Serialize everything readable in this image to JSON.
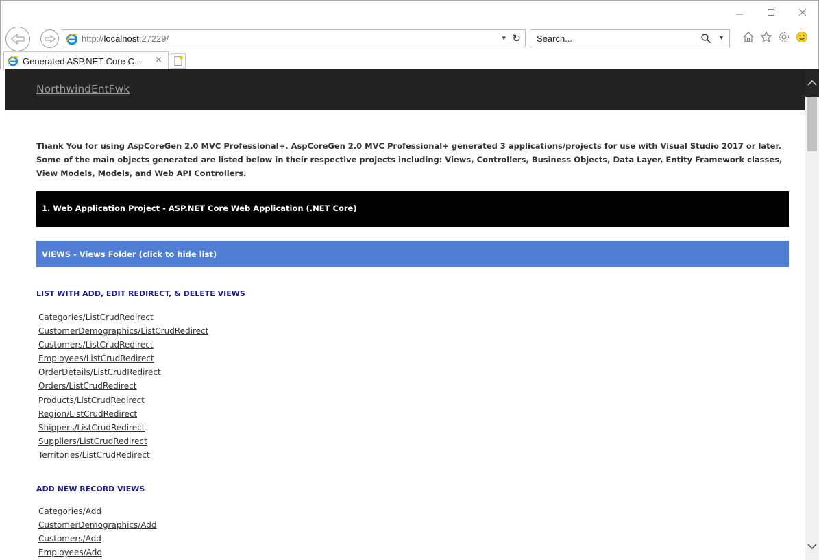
{
  "browser": {
    "url_prefix": "http://",
    "url_host": "localhost",
    "url_rest": ":27229/",
    "search_placeholder": "Search...",
    "tab_title": "Generated ASP.NET Core C...",
    "tab_close": "×"
  },
  "site": {
    "brand": "NorthwindEntFwk"
  },
  "page": {
    "intro": "Thank You for using AspCoreGen 2.0 MVC Professional+. AspCoreGen 2.0 MVC Professional+ generated 3 applications/projects for use with Visual Studio 2017 or later. Some of the main objects generated are listed below in their respective projects including: Views, Controllers, Business Objects, Data Layer, Entity Framework classes, View Models, Models, and Web API Controllers.",
    "project_heading": "1. Web Application Project - ASP.NET Core Web Application (.NET Core)",
    "views_heading": "VIEWS - Views Folder (click to hide list)",
    "sections": [
      {
        "title": "LIST WITH ADD, EDIT REDIRECT, & DELETE VIEWS",
        "links": [
          "Categories/ListCrudRedirect",
          "CustomerDemographics/ListCrudRedirect",
          "Customers/ListCrudRedirect",
          "Employees/ListCrudRedirect",
          "OrderDetails/ListCrudRedirect",
          "Orders/ListCrudRedirect",
          "Products/ListCrudRedirect",
          "Region/ListCrudRedirect",
          "Shippers/ListCrudRedirect",
          "Suppliers/ListCrudRedirect",
          "Territories/ListCrudRedirect"
        ]
      },
      {
        "title": "ADD NEW RECORD VIEWS",
        "links": [
          "Categories/Add",
          "CustomerDemographics/Add",
          "Customers/Add",
          "Employees/Add"
        ]
      }
    ]
  },
  "colors": {
    "header_bg": "#222222",
    "project_bar_bg": "#000000",
    "views_bar_bg": "#517ed6",
    "section_title": "#1a1a8c"
  }
}
